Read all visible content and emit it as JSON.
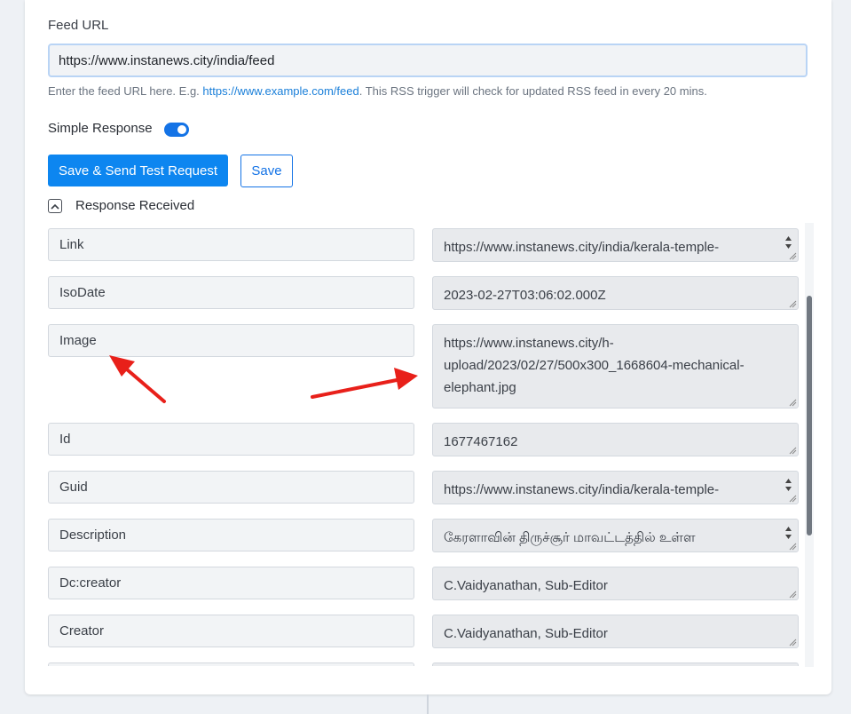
{
  "feed": {
    "label": "Feed URL",
    "value": "https://www.instanews.city/india/feed",
    "hint_prefix": "Enter the feed URL here. E.g. ",
    "hint_link": "https://www.example.com/feed",
    "hint_suffix": ". This RSS trigger will check for updated RSS feed in every 20 mins."
  },
  "simple_response": {
    "label": "Simple Response",
    "enabled": true
  },
  "buttons": {
    "save_send": "Save & Send Test Request",
    "save": "Save"
  },
  "response": {
    "label": "Response Received",
    "rows": [
      {
        "key": "Link",
        "value": "https://www.instanews.city/india/kerala-temple-"
      },
      {
        "key": "IsoDate",
        "value": "2023-02-27T03:06:02.000Z"
      },
      {
        "key": "Image",
        "value_lines": [
          "https://www.instanews.city/h-",
          "upload/2023/02/27/500x300_1668604-mechanical-",
          "elephant.jpg"
        ]
      },
      {
        "key": "Id",
        "value": "1677467162"
      },
      {
        "key": "Guid",
        "value": "https://www.instanews.city/india/kerala-temple-"
      },
      {
        "key": "Description",
        "value": "கேரளாவின் திருச்சூர் மாவட்டத்தில் உள்ள"
      },
      {
        "key": "Dc:creator",
        "value": "C.Vaidyanathan, Sub-Editor"
      },
      {
        "key": "Creator",
        "value": "C.Vaidyanathan, Sub-Editor"
      }
    ]
  },
  "colors": {
    "accent": "#0d86f0",
    "arrow": "#e8201a"
  }
}
